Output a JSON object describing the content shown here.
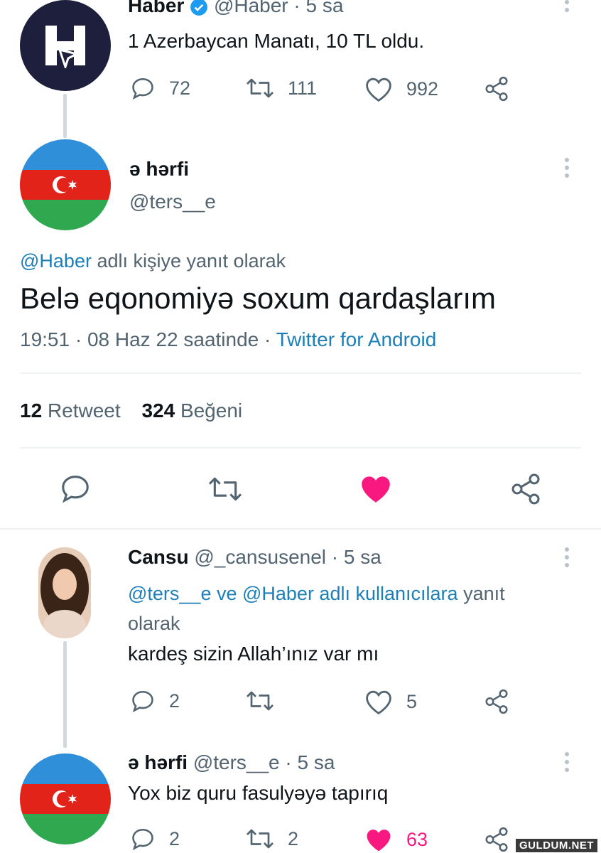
{
  "tweet1": {
    "name": "Haber",
    "handle": "@Haber",
    "time": "· 5 sa",
    "text": "1 Azerbaycan Manatı, 10 TL oldu.",
    "avatar_letter": "H",
    "replies": "72",
    "retweets": "111",
    "likes": "992"
  },
  "main": {
    "name": "ə hərfi",
    "handle": "@ters__e",
    "reply_to_mention": "@Haber",
    "reply_to_suffix": "adlı kişiye yanıt olarak",
    "text": "Belə eqonomiyə soxum qardaşlarım",
    "timestamp": "19:51 · 08 Haz 22 saatinde ·",
    "source": "Twitter for Android",
    "retweet_count": "12",
    "retweet_label": "Retweet",
    "like_count": "324",
    "like_label": "Beğeni"
  },
  "reply1": {
    "name": "Cansu",
    "handle": "@_cansusenel",
    "time": "· 5 sa",
    "reply_to_mentions": "@ters__e ve @Haber adlı kullanıcılara",
    "reply_to_suffix": "yanıt",
    "reply_to_suffix2": "olarak",
    "text": "kardeş sizin Allah’ınız var mı",
    "replies": "2",
    "likes": "5"
  },
  "reply2": {
    "name": "ə hərfi",
    "handle": "@ters__e",
    "time": "· 5 sa",
    "text": "Yox biz quru fasulyəyə tapırıq",
    "replies": "2",
    "retweets": "2",
    "likes": "63"
  },
  "watermark": "GULDUM.NET",
  "colors": {
    "like_active": "#f91880",
    "link": "#1d7fb8",
    "flag_blue": "#2f8fd8",
    "flag_red": "#e2231a",
    "flag_green": "#2fa84f",
    "haber_bg": "#1d1f3d"
  }
}
